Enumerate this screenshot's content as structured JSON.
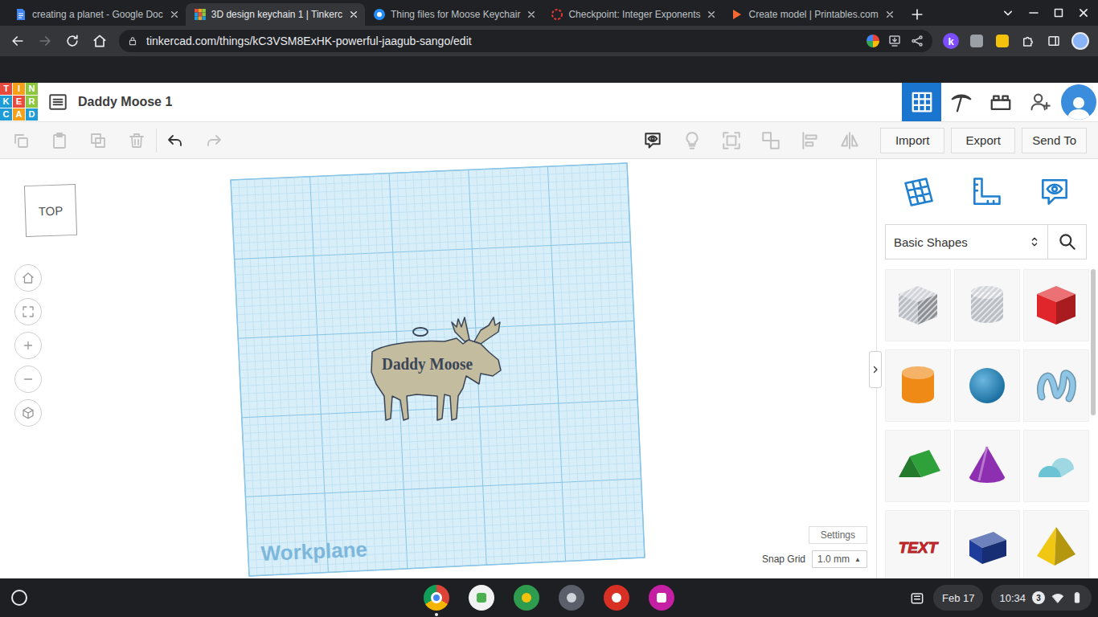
{
  "browser": {
    "tabs": [
      {
        "label": "creating a planet - Google Doc",
        "selected": false,
        "kind": "docs"
      },
      {
        "label": "3D design keychain 1 | Tinkerc",
        "selected": true,
        "kind": "tinkercad"
      },
      {
        "label": "Thing files for Moose Keychair",
        "selected": false,
        "kind": "thingiverse"
      },
      {
        "label": "Checkpoint: Integer Exponents",
        "selected": false,
        "kind": "checkpoint"
      },
      {
        "label": "Create model | Printables.com",
        "selected": false,
        "kind": "printables"
      }
    ],
    "url": "tinkercad.com/things/kC3VSM8ExHK-powerful-jaagub-sango/edit",
    "back_enabled": true,
    "forward_enabled": false,
    "extension_letter": "k"
  },
  "app": {
    "logo": [
      {
        "letter": "T",
        "color": "#e84a3d"
      },
      {
        "letter": "I",
        "color": "#f6a01a"
      },
      {
        "letter": "N",
        "color": "#8dc63f"
      },
      {
        "letter": "K",
        "color": "#1d9cd7"
      },
      {
        "letter": "E",
        "color": "#e84a3d"
      },
      {
        "letter": "R",
        "color": "#8dc63f"
      },
      {
        "letter": "C",
        "color": "#1d9cd7"
      },
      {
        "letter": "A",
        "color": "#f6a01a"
      },
      {
        "letter": "D",
        "color": "#1d9cd7"
      }
    ],
    "title": "Daddy Moose 1",
    "view_modes": [
      {
        "kind": "design",
        "selected": true
      },
      {
        "kind": "pickaxe",
        "selected": false
      },
      {
        "kind": "bricks",
        "selected": false
      }
    ],
    "edit_tools": [
      {
        "kind": "copy",
        "disabled": true
      },
      {
        "kind": "paste",
        "disabled": true
      },
      {
        "kind": "duplicate",
        "disabled": true
      },
      {
        "kind": "delete",
        "disabled": true
      },
      {
        "kind": "undo",
        "disabled": false
      },
      {
        "kind": "redo",
        "disabled": true
      }
    ],
    "view_tools": [
      {
        "kind": "notes",
        "disabled": false
      },
      {
        "kind": "bulb",
        "disabled": true
      },
      {
        "kind": "group",
        "disabled": true
      },
      {
        "kind": "ungroup",
        "disabled": true
      },
      {
        "kind": "align",
        "disabled": true
      },
      {
        "kind": "mirror",
        "disabled": true
      }
    ],
    "file_buttons": [
      "Import",
      "Export",
      "Send To"
    ],
    "view_cube": "TOP",
    "nav_buttons": [
      {
        "kind": "home"
      },
      {
        "kind": "fit"
      },
      {
        "kind": "zoomin"
      },
      {
        "kind": "zoomout"
      },
      {
        "kind": "perspective"
      }
    ],
    "workplane_label": "Workplane",
    "model_text": "Daddy Moose",
    "settings": "Settings",
    "snap_grid": {
      "label": "Snap Grid",
      "value": "1.0 mm",
      "arrow": "▲"
    },
    "panel": {
      "tools": [
        {
          "kind": "workplane"
        },
        {
          "kind": "ruler"
        },
        {
          "kind": "notes"
        }
      ],
      "category": "Basic Shapes",
      "shapes": [
        {
          "kind": "box-hole",
          "color": "#b9bdc4"
        },
        {
          "kind": "cylinder-hole",
          "color": "#b9bdc4"
        },
        {
          "kind": "box",
          "color": "#e0252b"
        },
        {
          "kind": "cylinder",
          "color": "#f08a16"
        },
        {
          "kind": "sphere",
          "color": "#1c8fd0"
        },
        {
          "kind": "scribble",
          "color": "#8fc6e6"
        },
        {
          "kind": "roof",
          "color": "#2fa13a"
        },
        {
          "kind": "cone",
          "color": "#8e2fb2"
        },
        {
          "kind": "round-roof",
          "color": "#6cc3d3"
        },
        {
          "kind": "text",
          "color": "#d6252b",
          "label": "TEXT"
        },
        {
          "kind": "prism",
          "color": "#1e3d9a"
        },
        {
          "kind": "pyramid",
          "color": "#f0c814"
        }
      ]
    }
  },
  "shelf": {
    "apps": [
      {
        "kind": "chrome",
        "color": "#4285f4",
        "active": true
      },
      {
        "kind": "ixl",
        "color": "#f2f2f2",
        "active": false
      },
      {
        "kind": "star",
        "color": "#2e9c4e",
        "active": false
      },
      {
        "kind": "owl",
        "color": "#5a5f6a",
        "active": false
      },
      {
        "kind": "drop",
        "color": "#d93025",
        "active": false
      },
      {
        "kind": "canvas",
        "color": "#c51fa3",
        "active": false
      }
    ],
    "date": "Feb 17",
    "time": "10:34",
    "notifications": "3"
  }
}
